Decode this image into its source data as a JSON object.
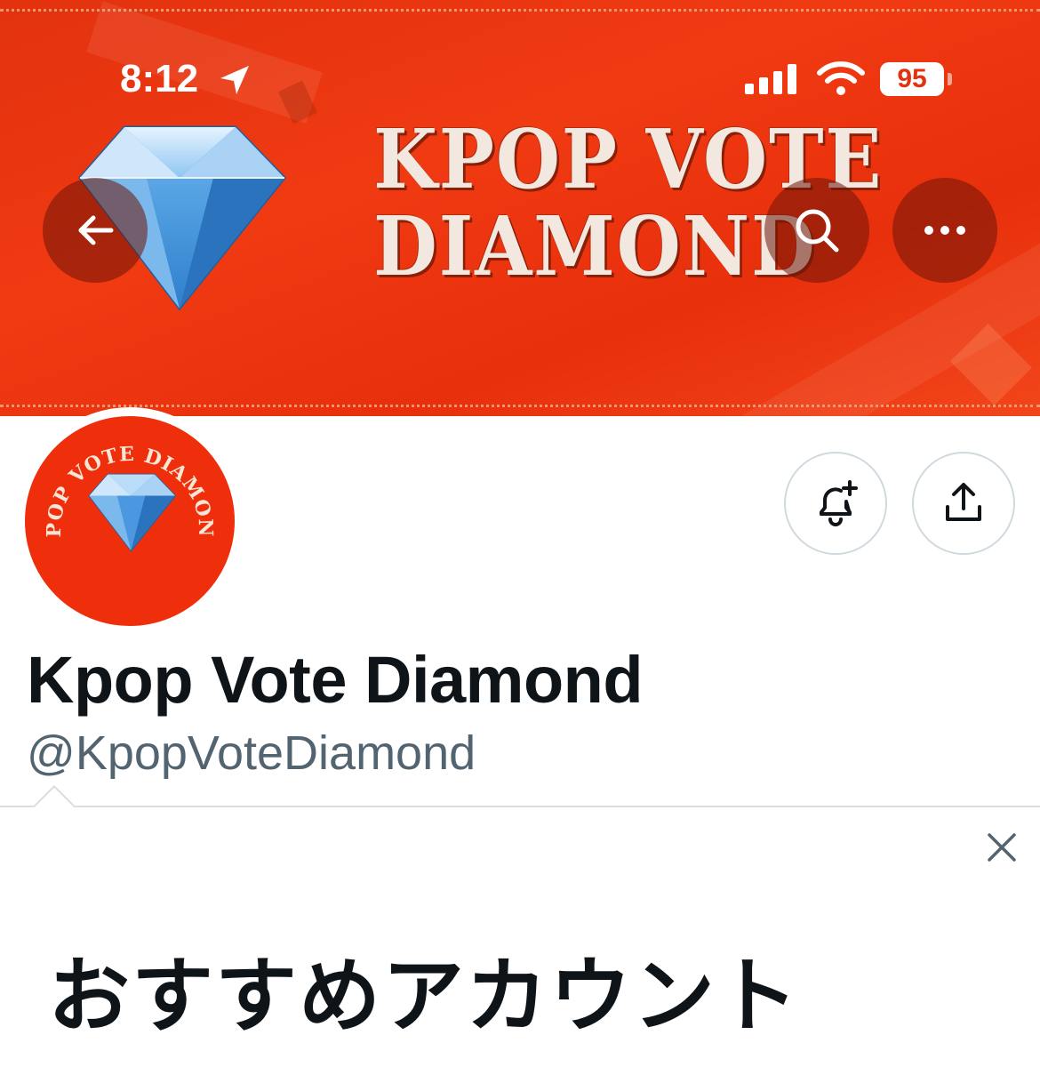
{
  "status_bar": {
    "time": "8:12",
    "battery": "95",
    "icons": [
      "location-arrow-icon",
      "cellular-signal-icon",
      "wifi-icon",
      "battery-icon"
    ]
  },
  "banner": {
    "line1": "KPOP VOTE",
    "line2": "DIAMOND",
    "background_color": "#e8320e",
    "text_color": "#f2e8df"
  },
  "header_actions": {
    "back_icon": "arrow-left-icon",
    "search_icon": "search-icon",
    "more_icon": "more-dots-icon"
  },
  "avatar": {
    "arc_text": "KPOP VOTE DIAMOND",
    "background_color": "#ef2e0b"
  },
  "profile_actions": {
    "notify_icon": "bell-plus-icon",
    "share_icon": "share-icon"
  },
  "profile": {
    "display_name": "Kpop Vote Diamond",
    "handle": "@KpopVoteDiamond"
  },
  "recommendations": {
    "title": "おすすめアカウント",
    "close_icon": "close-icon"
  },
  "colors": {
    "text_primary": "#0f1419",
    "text_secondary": "#536471",
    "border": "#cfd9de"
  }
}
